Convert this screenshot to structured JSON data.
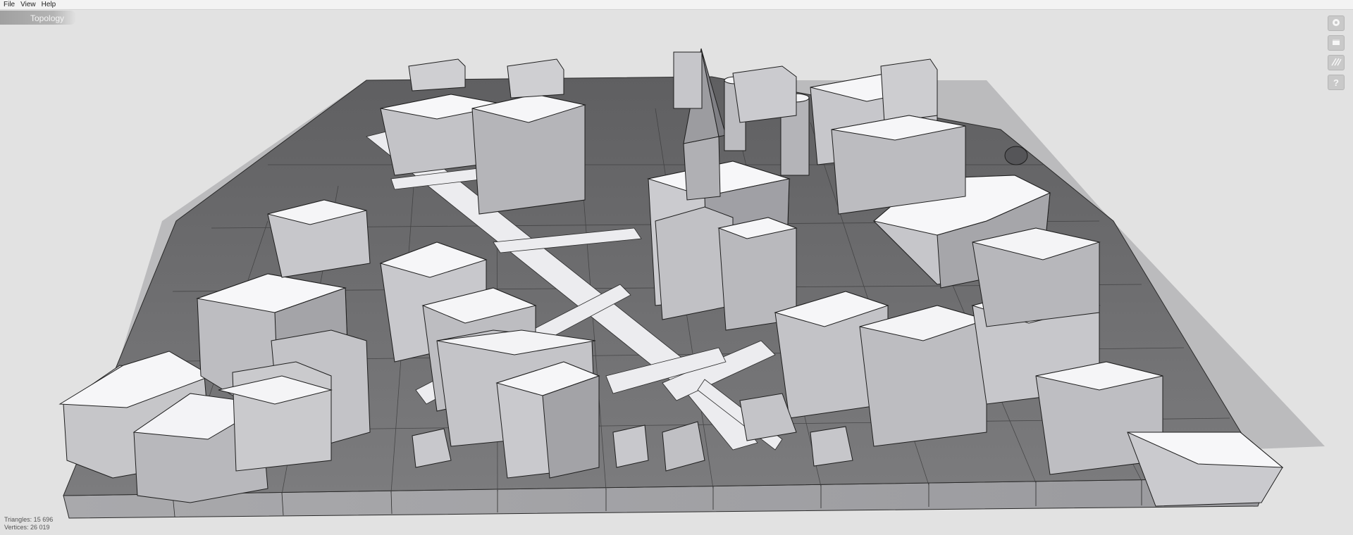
{
  "menu": {
    "file": "File",
    "view": "View",
    "help": "Help"
  },
  "tab": {
    "label": "Topology"
  },
  "toolbar": {
    "tools": [
      {
        "icon": "camera-orbit-icon"
      },
      {
        "icon": "window-icon"
      },
      {
        "icon": "texture-hatch-icon"
      },
      {
        "icon": "help-icon",
        "glyph": "?"
      }
    ]
  },
  "stats": {
    "triangles": "Triangles: 15 696",
    "vertices": "Vertices: 26 019"
  },
  "colors": {
    "background": "#e2e2e2",
    "roof": "#f6f6f8",
    "wall_light": "#cfcfd2",
    "wall_dark": "#8f8f93",
    "ground": "#6d6d6f",
    "edge": "#2a2a2a"
  }
}
